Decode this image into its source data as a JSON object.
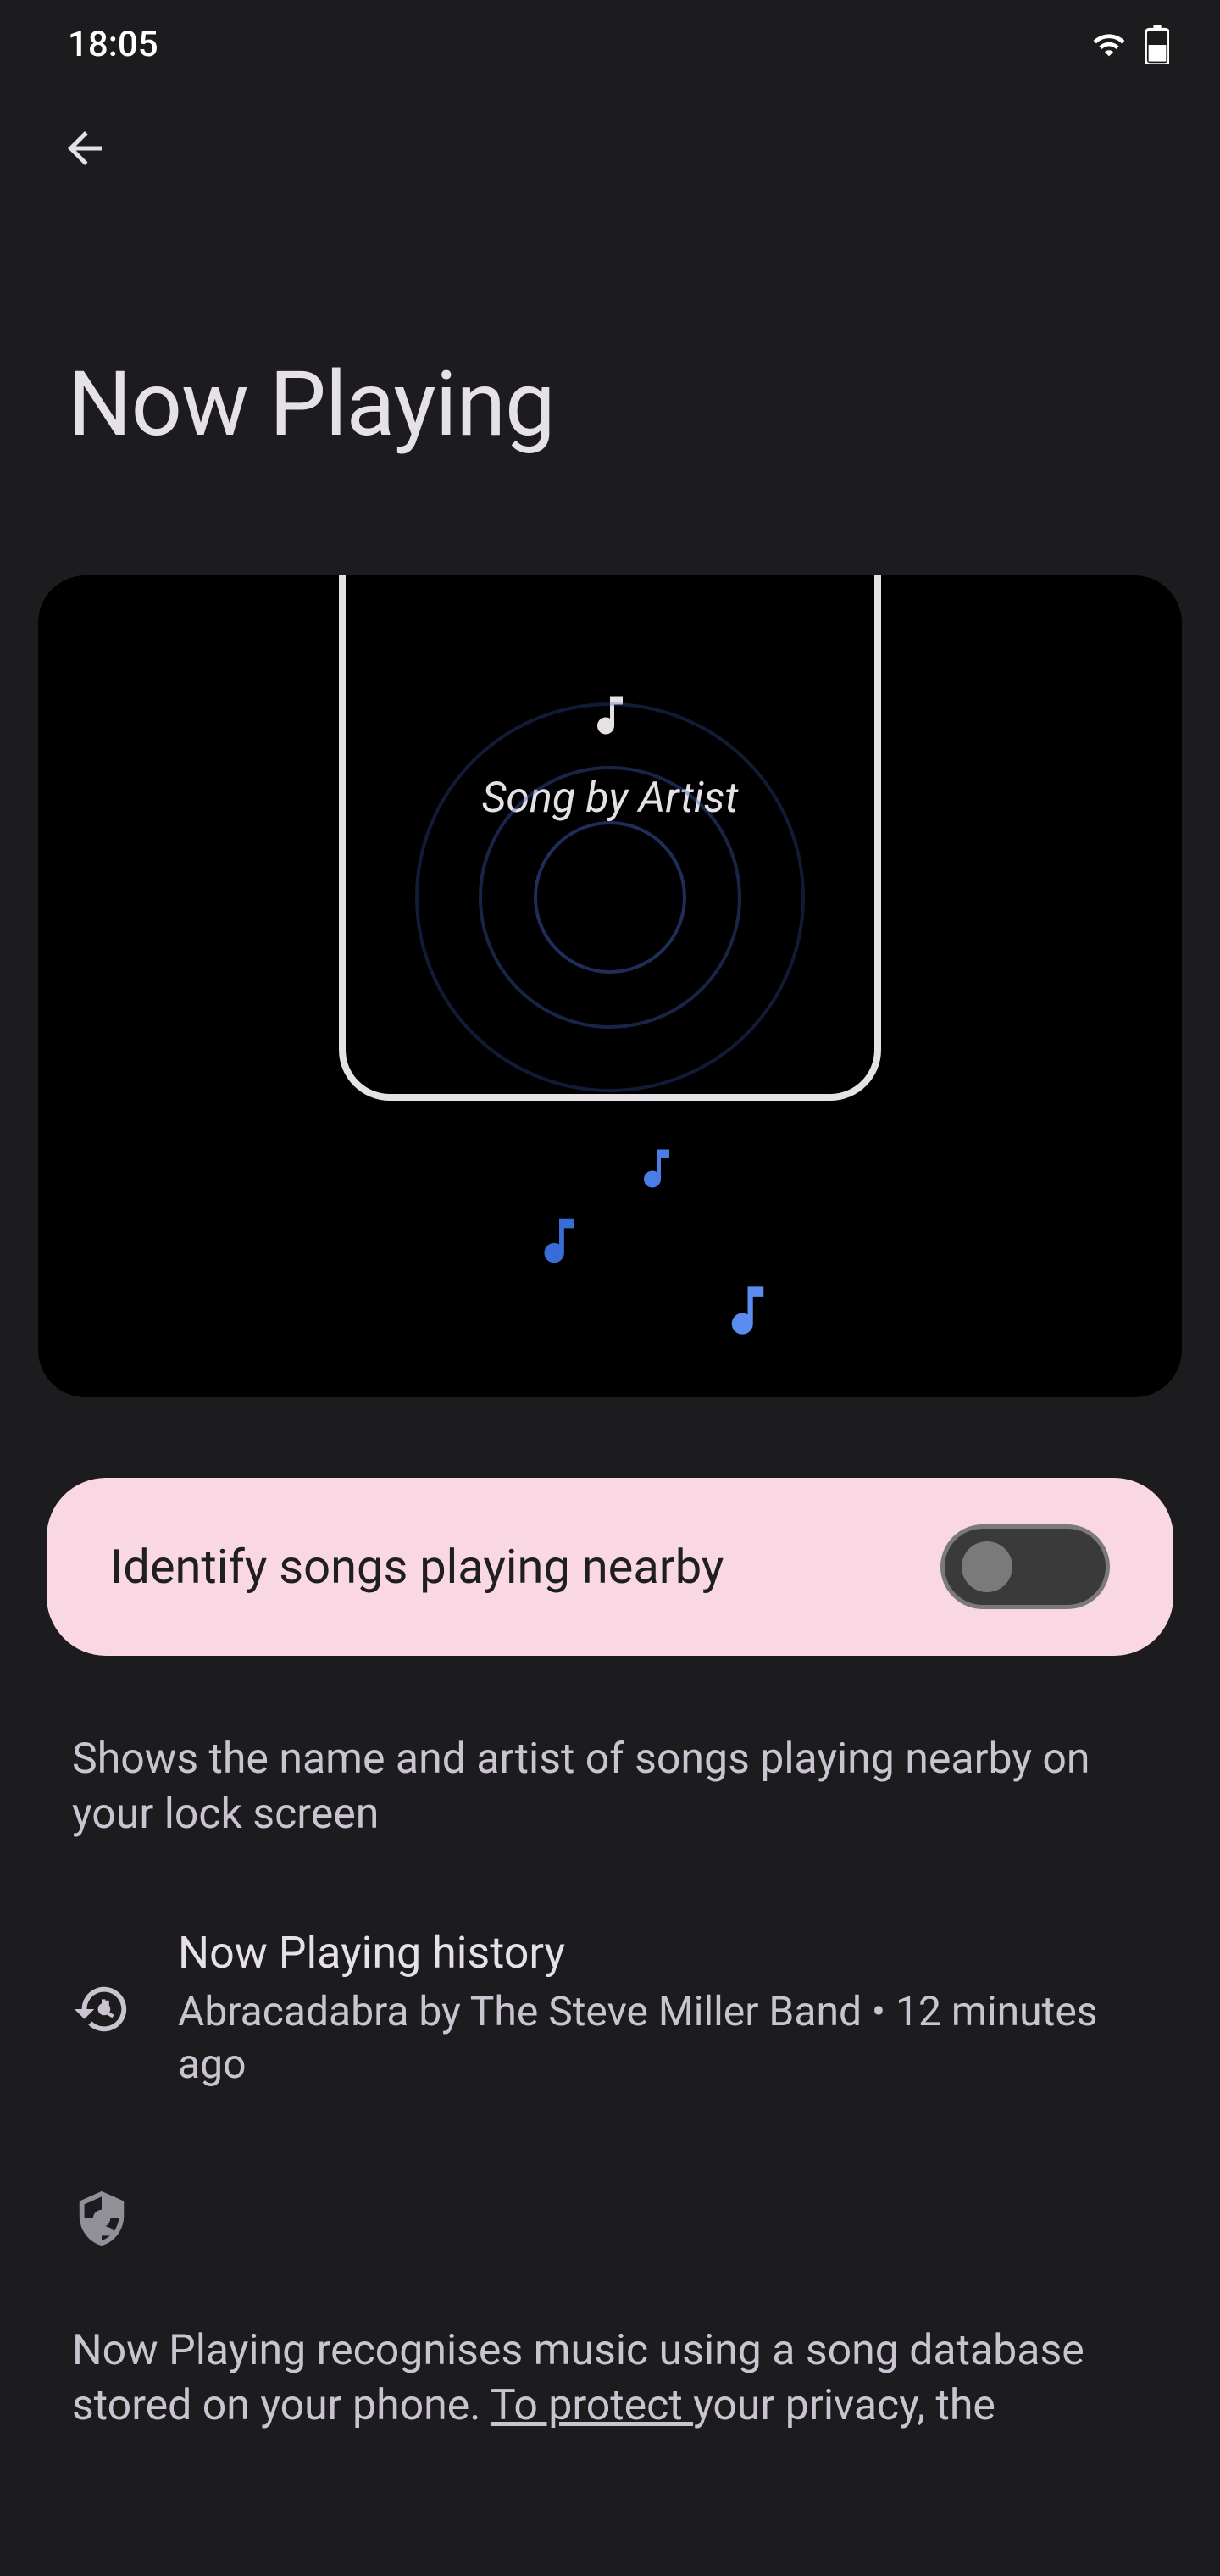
{
  "statusBar": {
    "time": "18:05"
  },
  "pageTitle": "Now Playing",
  "illustration": {
    "songLabel": "Song by Artist"
  },
  "toggle": {
    "label": "Identify songs playing nearby",
    "enabled": false
  },
  "description": "Shows the name and artist of songs playing nearby on your lock screen",
  "history": {
    "title": "Now Playing history",
    "subtitle": "Abracadabra by The Steve Miller Band • 12 minutes ago"
  },
  "privacy": {
    "textPart1": "Now Playing recognises music using a song database stored on your phone. ",
    "linkText": "To protect ",
    "textPart2": "your privacy, the"
  }
}
